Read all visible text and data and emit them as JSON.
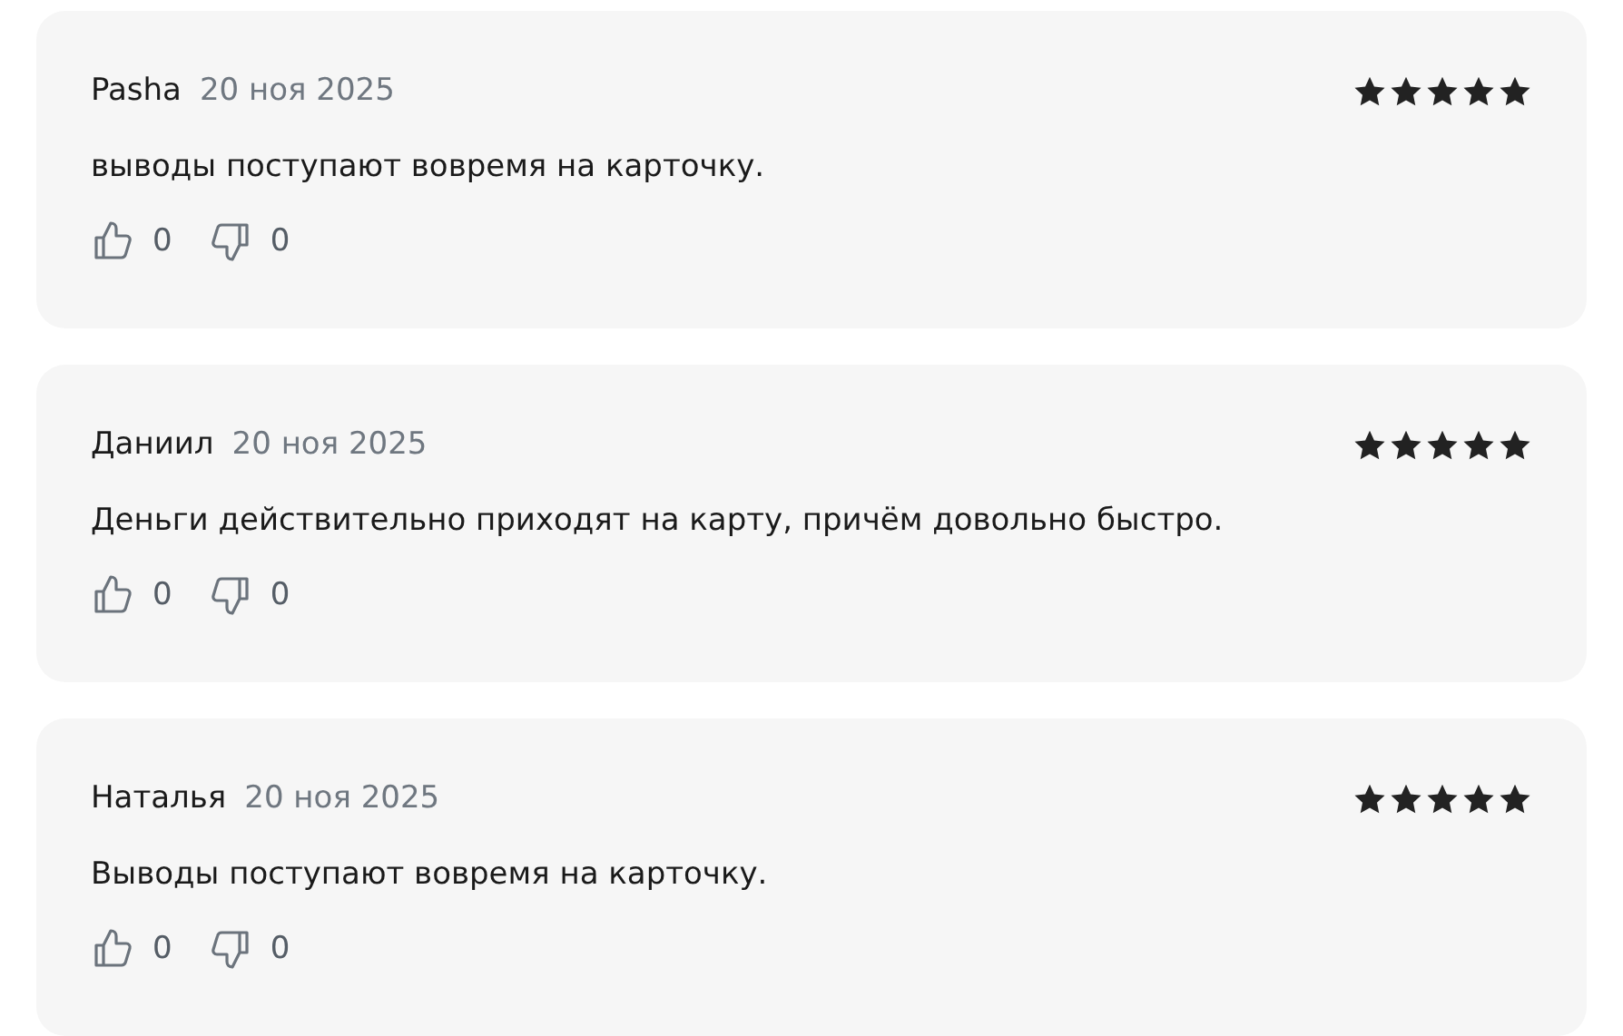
{
  "reviews": [
    {
      "author": "Pasha",
      "date": "20 ноя 2025",
      "stars": 5,
      "text": "выводы поступают вовремя на карточку.",
      "likes": "0",
      "dislikes": "0"
    },
    {
      "author": "Даниил",
      "date": "20 ноя 2025",
      "stars": 5,
      "text": "Деньги действительно приходят на карту, причём довольно быстро.",
      "likes": "0",
      "dislikes": "0"
    },
    {
      "author": "Наталья",
      "date": "20 ноя 2025",
      "stars": 5,
      "text": "Выводы поступают вовремя на карточку.",
      "likes": "0",
      "dislikes": "0"
    }
  ]
}
